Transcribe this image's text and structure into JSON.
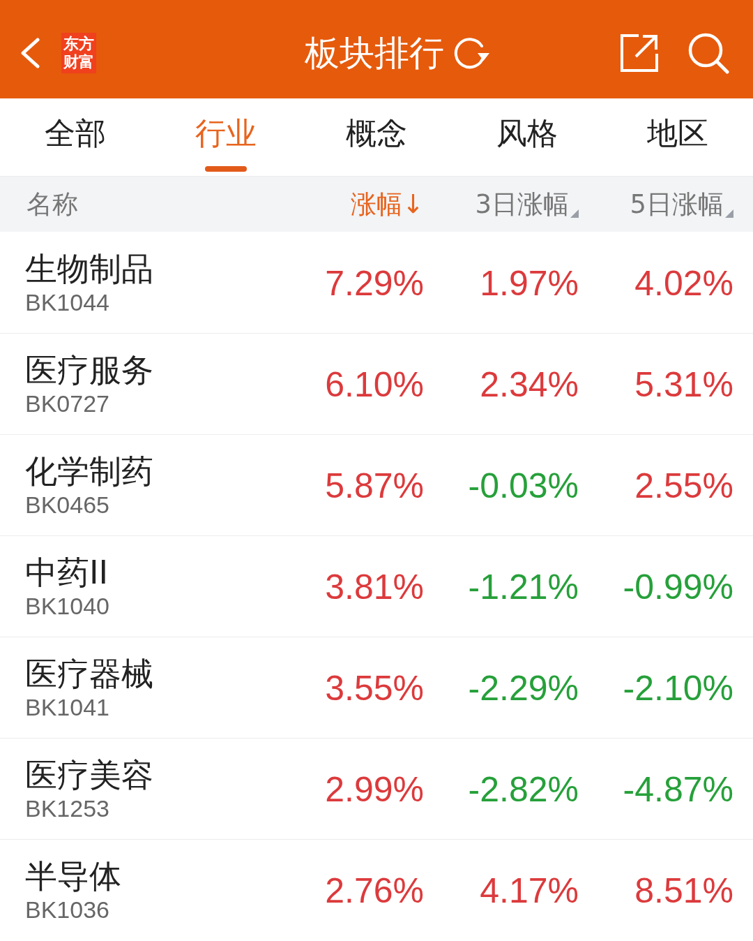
{
  "header": {
    "logo": [
      "东方",
      "财富"
    ],
    "title": "板块排行"
  },
  "tabs": [
    {
      "label": "全部",
      "selected": false
    },
    {
      "label": "行业",
      "selected": true
    },
    {
      "label": "概念",
      "selected": false
    },
    {
      "label": "风格",
      "selected": false
    },
    {
      "label": "地区",
      "selected": false
    }
  ],
  "table": {
    "name_column": "名称",
    "columns": [
      {
        "label": "涨幅↓",
        "selected": true
      },
      {
        "label": "3日涨幅",
        "selected": false
      },
      {
        "label": "5日涨幅",
        "selected": false
      }
    ],
    "rows": [
      {
        "name": "生物制品",
        "code": "BK1044",
        "values": [
          {
            "text": "7.29%",
            "color": "#dc3a3c"
          },
          {
            "text": "1.97%",
            "color": "#dc3a3c"
          },
          {
            "text": "4.02%",
            "color": "#dc3a3c"
          }
        ]
      },
      {
        "name": "医疗服务",
        "code": "BK0727",
        "values": [
          {
            "text": "6.10%",
            "color": "#dc3a3c"
          },
          {
            "text": "2.34%",
            "color": "#dc3a3c"
          },
          {
            "text": "5.31%",
            "color": "#dc3a3c"
          }
        ]
      },
      {
        "name": "化学制药",
        "code": "BK0465",
        "values": [
          {
            "text": "5.87%",
            "color": "#dc3a3c"
          },
          {
            "text": "-0.03%",
            "color": "#26a03a"
          },
          {
            "text": "2.55%",
            "color": "#dc3a3c"
          }
        ]
      },
      {
        "name": "中药II",
        "code": "BK1040",
        "values": [
          {
            "text": "3.81%",
            "color": "#dc3a3c"
          },
          {
            "text": "-1.21%",
            "color": "#26a03a"
          },
          {
            "text": "-0.99%",
            "color": "#26a03a"
          }
        ]
      },
      {
        "name": "医疗器械",
        "code": "BK1041",
        "values": [
          {
            "text": "3.55%",
            "color": "#dc3a3c"
          },
          {
            "text": "-2.29%",
            "color": "#26a03a"
          },
          {
            "text": "-2.10%",
            "color": "#26a03a"
          }
        ]
      },
      {
        "name": "医疗美容",
        "code": "BK1253",
        "values": [
          {
            "text": "2.99%",
            "color": "#dc3a3c"
          },
          {
            "text": "-2.82%",
            "color": "#26a03a"
          },
          {
            "text": "-4.87%",
            "color": "#26a03a"
          }
        ]
      },
      {
        "name": "半导体",
        "code": "BK1036",
        "values": [
          {
            "text": "2.76%",
            "color": "#dc3a3c"
          },
          {
            "text": "4.17%",
            "color": "#dc3a3c"
          },
          {
            "text": "8.51%",
            "color": "#dc3a3c"
          }
        ]
      }
    ]
  }
}
